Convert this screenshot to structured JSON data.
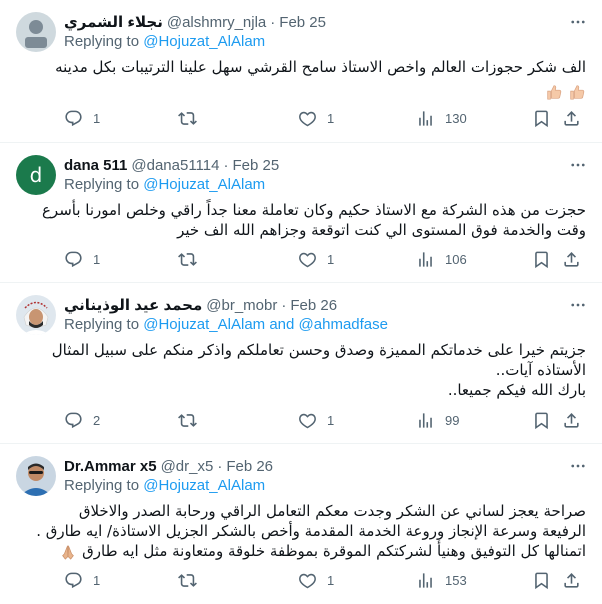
{
  "tweets": [
    {
      "name": "نجلاء الشمري",
      "handle": "@alshmry_njla",
      "date": "Feb 25",
      "replying_prefix": "Replying to",
      "replying_to": "@Hojuzat_AlAlam",
      "lines": [
        "الف شكر حجوزات العالم واخص الاستاذ سامح القرشي سهل علينا الترتيبات بكل مدينه"
      ],
      "emoji_line": [
        "thumbs-up-icon",
        "thumbs-up-icon"
      ],
      "replies": "1",
      "retweets": "",
      "likes": "1",
      "views": "130"
    },
    {
      "name": "dana 511",
      "handle": "@dana51114",
      "date": "Feb 25",
      "avatar_letter": "d",
      "replying_prefix": "Replying to",
      "replying_to": "@Hojuzat_AlAlam",
      "lines": [
        "حجزت من هذه الشركة مع الاستاذ حكيم وكان تعاملة معنا جداً راقي وخلص امورنا بأسرع",
        "وقت والخدمة فوق المستوى الي كنت اتوقعة وجزاهم الله الف خير"
      ],
      "replies": "1",
      "retweets": "",
      "likes": "1",
      "views": "106"
    },
    {
      "name": "محمد عيد الوذيناني",
      "handle": "@br_mobr",
      "date": "Feb 26",
      "replying_prefix": "Replying to",
      "replying_to": "@Hojuzat_AlAlam",
      "replying_and": "and",
      "replying_to2": "@ahmadfase",
      "lines": [
        "جزيتم خيرا على خدماتكم المميزة وصدق وحسن تعاملكم واذكر منكم على سبيل المثال",
        "الأستاذه آيات..",
        "بارك الله فيكم جميعا.."
      ],
      "replies": "2",
      "retweets": "",
      "likes": "1",
      "views": "99"
    },
    {
      "name": "Dr.Ammar x5",
      "handle": "@dr_x5",
      "date": "Feb 26",
      "replying_prefix": "Replying to",
      "replying_to": "@Hojuzat_AlAlam",
      "lines": [
        "صراحة يعجز لساني عن الشكر وجدت معكم التعامل الراقي ورحابة الصدر والاخلاق",
        "الرفيعة وسرعة الإنجاز وروعة الخدمة المقدمة وأخص بالشكر الجزيل الاستاذة/ ايه طارق .",
        "اتمنالها كل التوفيق وهنيأ لشركتكم الموقرة بموظفة خلوقة ومتعاونة مثل ايه طارق"
      ],
      "emoji_end": "praying-hands-icon",
      "replies": "1",
      "retweets": "",
      "likes": "1",
      "views": "153"
    }
  ],
  "colors": {
    "link": "#1d9bf0",
    "secondary_text": "#536471",
    "primary_text": "#0f1419",
    "divider": "#eff3f4",
    "dana_avatar": "#1b7a4c"
  }
}
